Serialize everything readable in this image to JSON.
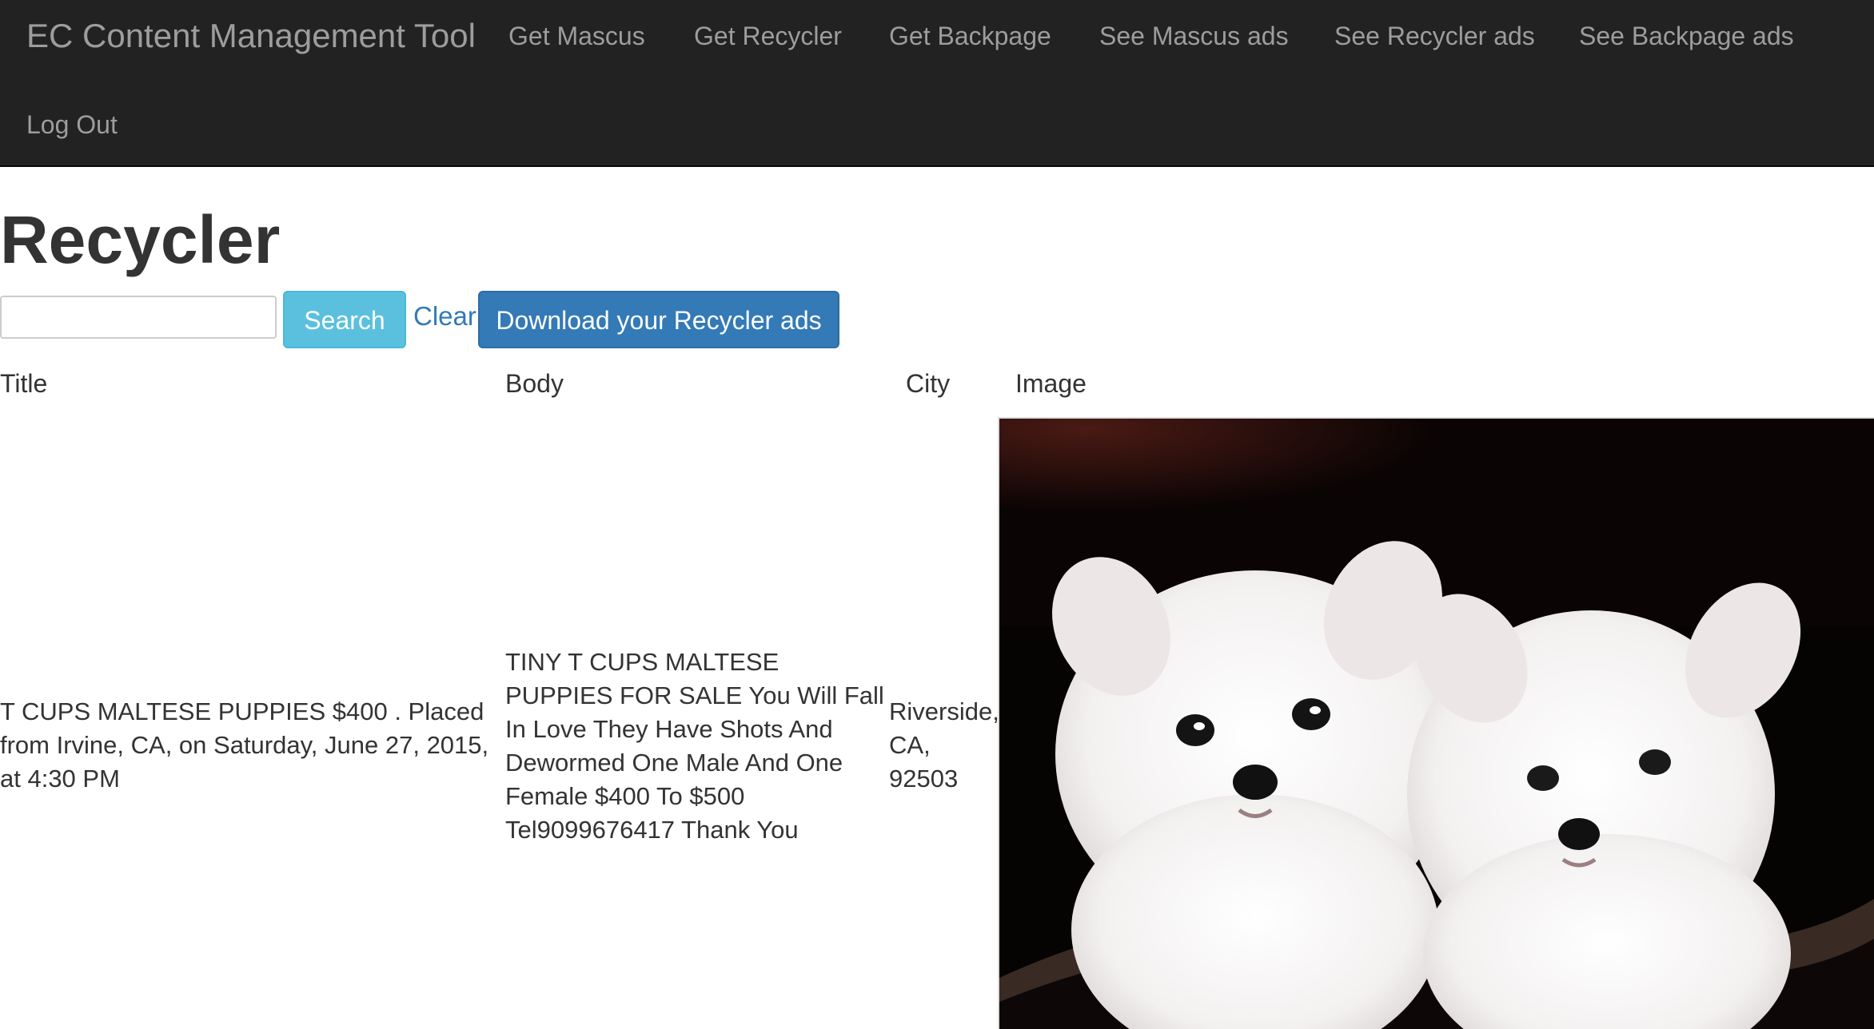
{
  "navbar": {
    "brand": "EC Content Management Tool",
    "links": [
      "Get Mascus",
      "Get Recycler",
      "Get Backpage",
      "See Mascus ads",
      "See Recycler ads",
      "See Backpage ads"
    ],
    "logout": "Log Out"
  },
  "page": {
    "title": "Recycler"
  },
  "search": {
    "value": "",
    "search_label": "Search",
    "clear_label": "Clear",
    "download_label": "Download your Recycler ads"
  },
  "table": {
    "headers": [
      "Title",
      "Body",
      "City",
      "Image"
    ],
    "rows": [
      {
        "title": "T CUPS MALTESE PUPPIES $400 . Placed from Irvine, CA, on Saturday, June 27, 2015, at 4:30 PM",
        "body": "TINY T CUPS MALTESE PUPPIES FOR SALE You Will Fall In Love They Have Shots And Dewormed One Male And One Female $400 To $500 Tel9099676417 Thank You",
        "city": "Riverside, CA, 92503"
      }
    ]
  },
  "colors": {
    "navbar_bg": "#222222",
    "nav_text": "#9d9d9d",
    "search_button": "#5bc0de",
    "primary_button": "#337ab7",
    "link": "#337ab7"
  }
}
